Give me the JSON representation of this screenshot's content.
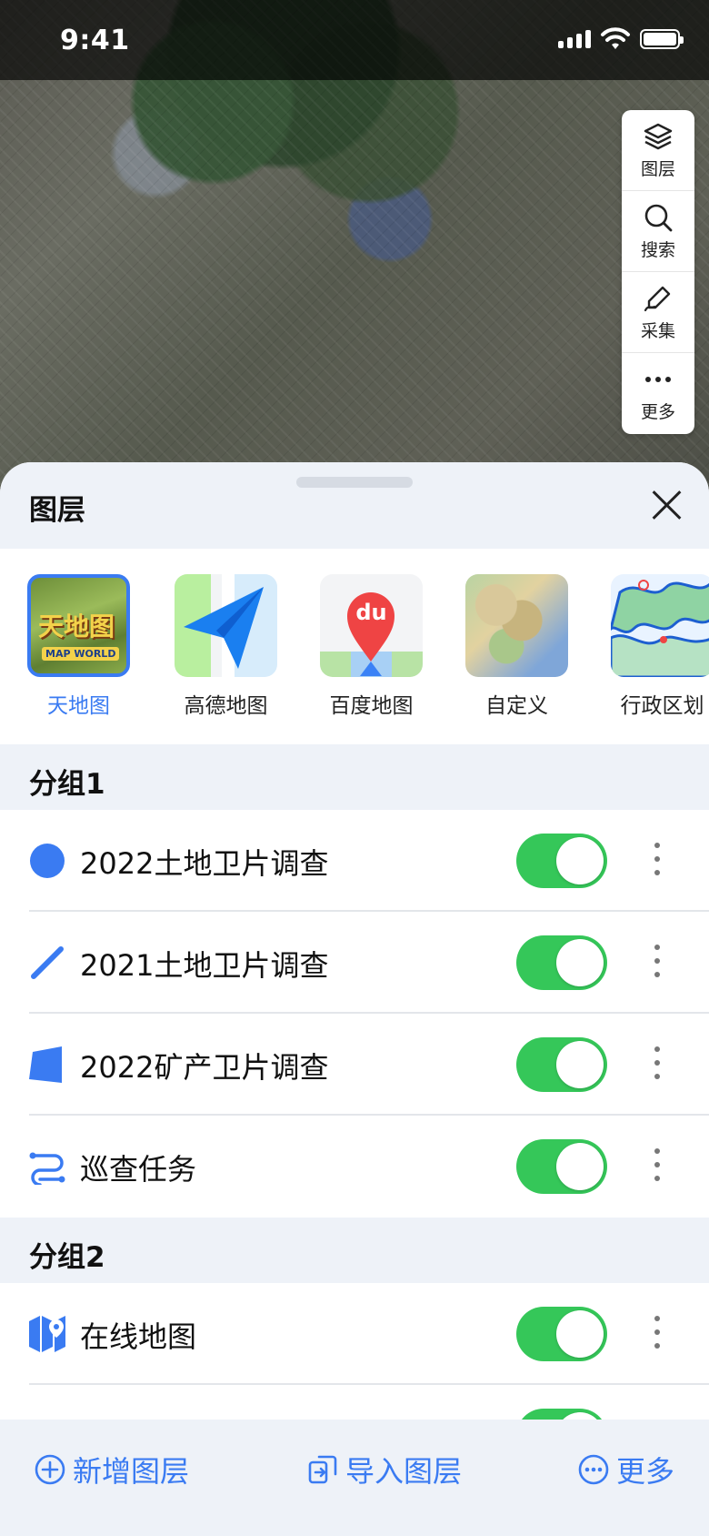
{
  "status_bar": {
    "time": "9:41"
  },
  "map_toolbar": [
    {
      "label": "图层",
      "icon": "layers-icon"
    },
    {
      "label": "搜索",
      "icon": "search-icon"
    },
    {
      "label": "采集",
      "icon": "pen-icon"
    },
    {
      "label": "更多",
      "icon": "more-icon"
    }
  ],
  "sheet": {
    "title": "图层"
  },
  "basemaps": [
    {
      "name": "天地图",
      "active": true
    },
    {
      "name": "高德地图",
      "active": false
    },
    {
      "name": "百度地图",
      "active": false
    },
    {
      "name": "自定义",
      "active": false
    },
    {
      "name": "行政区划",
      "active": false
    }
  ],
  "basemap_badges": {
    "tianditu_text": "天地图",
    "tianditu_sub": "MAP WORLD",
    "baidu_text": "du"
  },
  "groups": [
    {
      "name": "分组1",
      "layers": [
        {
          "name": "2022土地卫片调查",
          "icon": "point-layer-icon",
          "enabled": true
        },
        {
          "name": "2021土地卫片调查",
          "icon": "line-layer-icon",
          "enabled": true
        },
        {
          "name": "2022矿产卫片调查",
          "icon": "polygon-layer-icon",
          "enabled": true
        },
        {
          "name": "巡查任务",
          "icon": "route-layer-icon",
          "enabled": true
        }
      ]
    },
    {
      "name": "分组2",
      "layers": [
        {
          "name": "在线地图",
          "icon": "online-map-icon",
          "enabled": true
        }
      ]
    }
  ],
  "bottom_actions": [
    {
      "label": "新增图层",
      "icon": "add-circle-icon"
    },
    {
      "label": "导入图层",
      "icon": "import-icon"
    },
    {
      "label": "更多",
      "icon": "more-circle-icon"
    }
  ],
  "colors": {
    "accent": "#3A7BF2",
    "toggle_on": "#35C759",
    "section_bg": "#EEF2F8"
  }
}
